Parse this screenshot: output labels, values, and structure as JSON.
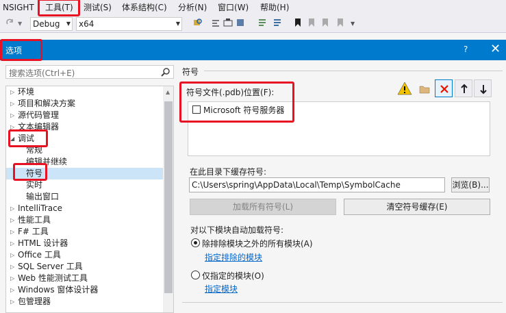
{
  "menubar": {
    "items": [
      "NSIGHT",
      "工具(T)",
      "测试(S)",
      "体系结构(C)",
      "分析(N)",
      "窗口(W)",
      "帮助(H)"
    ]
  },
  "toolbar": {
    "config_value": "Debug",
    "platform_value": "x64"
  },
  "dialog": {
    "title": "选项",
    "help": "?",
    "close": "✕"
  },
  "search": {
    "placeholder": "搜索选项(Ctrl+E)"
  },
  "tree": {
    "items": [
      {
        "label": "环境",
        "arrow": "▷"
      },
      {
        "label": "项目和解决方案",
        "arrow": "▷"
      },
      {
        "label": "源代码管理",
        "arrow": "▷"
      },
      {
        "label": "文本编辑器",
        "arrow": "▷"
      },
      {
        "label": "调试",
        "arrow": "◢"
      },
      {
        "label": "常规",
        "arrow": ""
      },
      {
        "label": "编辑并继续",
        "arrow": ""
      },
      {
        "label": "符号",
        "arrow": ""
      },
      {
        "label": "实时",
        "arrow": ""
      },
      {
        "label": "输出窗口",
        "arrow": ""
      },
      {
        "label": "IntelliTrace",
        "arrow": "▷"
      },
      {
        "label": "性能工具",
        "arrow": "▷"
      },
      {
        "label": "F# 工具",
        "arrow": "▷"
      },
      {
        "label": "HTML 设计器",
        "arrow": "▷"
      },
      {
        "label": "Office 工具",
        "arrow": "▷"
      },
      {
        "label": "SQL Server 工具",
        "arrow": "▷"
      },
      {
        "label": "Web 性能测试工具",
        "arrow": "▷"
      },
      {
        "label": "Windows 窗体设计器",
        "arrow": "▷"
      },
      {
        "label": "包管理器",
        "arrow": "▷"
      }
    ]
  },
  "symbols": {
    "section_title": "符号",
    "locations_label": "符号文件(.pdb)位置(F):",
    "servers": [
      {
        "label": "Microsoft 符号服务器",
        "checked": false
      }
    ],
    "cache_label": "在此目录下缓存符号:",
    "cache_path": "C:\\Users\\spring\\AppData\\Local\\Temp\\SymbolCache",
    "browse_button": "浏览(B)...",
    "load_all_button": "加载所有符号(L)",
    "clear_cache_button": "清空符号缓存(E)",
    "auto_load_label": "对以下模块自动加载符号:",
    "option_all_but_excluded": "除排除模块之外的所有模块(A)",
    "link_excluded": "指定排除的模块",
    "option_only_specified": "仅指定的模块(O)",
    "link_specified": "指定模块"
  },
  "colors": {
    "accent": "#007acc",
    "annotation": "#e81123",
    "link": "#0066cc",
    "selection": "#cce4f7"
  }
}
